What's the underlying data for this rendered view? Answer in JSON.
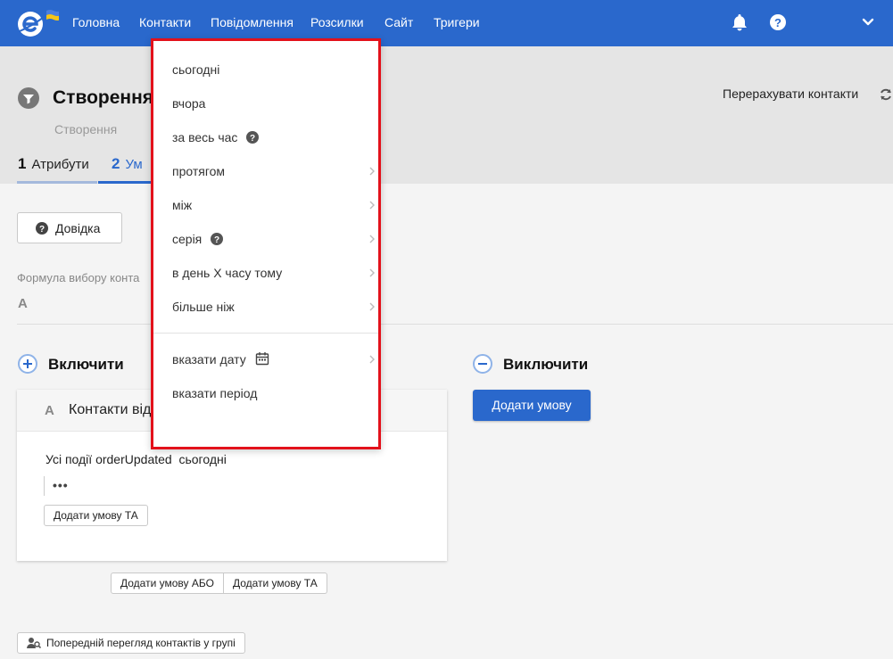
{
  "nav": {
    "items": [
      "Головна",
      "Контакти",
      "Повідомлення",
      "Розсилки",
      "Сайт",
      "Тригери"
    ]
  },
  "header": {
    "title": "Створення",
    "subtitle": "Створення",
    "recalc_label": "Перерахувати контакти",
    "steps": [
      {
        "num": "1",
        "label": "Атрибути"
      },
      {
        "num": "2",
        "label": "Ум"
      }
    ]
  },
  "main": {
    "help_button": "Довідка",
    "formula_label": "Формула вибору конта",
    "formula_value": "A",
    "include": {
      "title": "Включити",
      "card_letter": "A",
      "card_title": "Контакти від",
      "rule_text": "Усі події orderUpdated  сьогодні",
      "rule_dots": "•••",
      "add_and_button": "Додати умову ТА"
    },
    "exclude": {
      "title": "Виключити",
      "add_button": "Додати умову"
    },
    "add_or_button": "Додати умову АБО",
    "add_and_button": "Додати умову ТА",
    "preview_button": "Попередній перегляд контактів у групі"
  },
  "dropdown": {
    "items": [
      {
        "label": "сьогодні"
      },
      {
        "label": "вчора"
      },
      {
        "label": "за весь час"
      },
      {
        "label": "протягом"
      },
      {
        "label": "між"
      },
      {
        "label": "серія"
      },
      {
        "label": "в день Х часу тому"
      },
      {
        "label": "більше ніж"
      },
      {
        "label": "вказати дату"
      },
      {
        "label": "вказати період"
      }
    ]
  },
  "colors": {
    "brand_blue": "#2a68cc",
    "highlight_red": "#e3111b",
    "logo_flag_blue": "#4a7fe0",
    "logo_flag_yellow": "#f5c518"
  }
}
